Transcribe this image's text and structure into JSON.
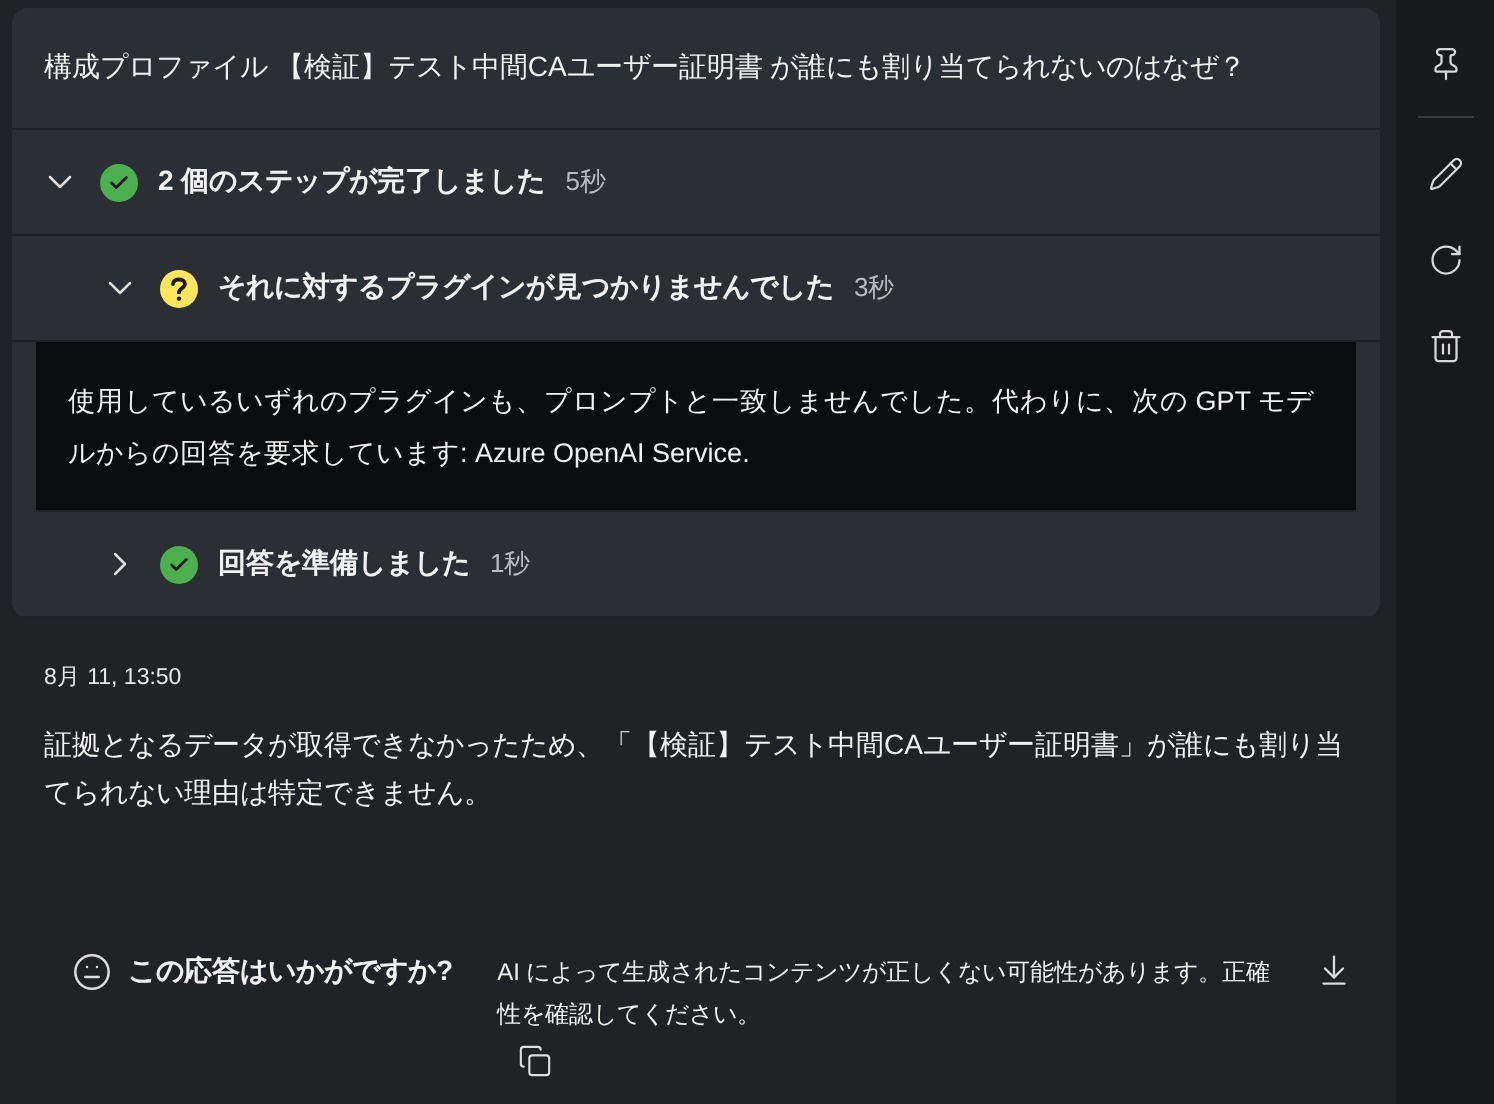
{
  "question": "構成プロファイル 【検証】テスト中間CAユーザー証明書 が誰にも割り当てられないのはなぜ？",
  "steps": [
    {
      "label": "2 個のステップが完了しました",
      "duration": "5秒",
      "kind": "done",
      "expanded": true,
      "children": [
        {
          "label": "それに対するプラグインが見つかりませんでした",
          "duration": "3秒",
          "kind": "unknown",
          "expanded": true,
          "detail": "使用しているいずれのプラグインも、プロンプトと一致しませんでした。代わりに、次の GPT モデルからの回答を要求しています: Azure OpenAI Service."
        },
        {
          "label": "回答を準備しました",
          "duration": "1秒",
          "kind": "done",
          "expanded": false
        }
      ]
    }
  ],
  "timestamp": "8月 11, 13:50",
  "answer": "証拠となるデータが取得できなかったため、「【検証】テスト中間CAユーザー証明書」が誰にも割り当てられない理由は特定できません。",
  "feedback": {
    "label": "この応答はいかがですか?"
  },
  "disclaimer": "AI によって生成されたコンテンツが正しくない可能性があります。正確性を確認してください。",
  "sidebar": [
    {
      "kind": "pin"
    },
    {
      "kind": "divider"
    },
    {
      "kind": "edit"
    },
    {
      "kind": "refresh"
    },
    {
      "kind": "delete"
    }
  ]
}
